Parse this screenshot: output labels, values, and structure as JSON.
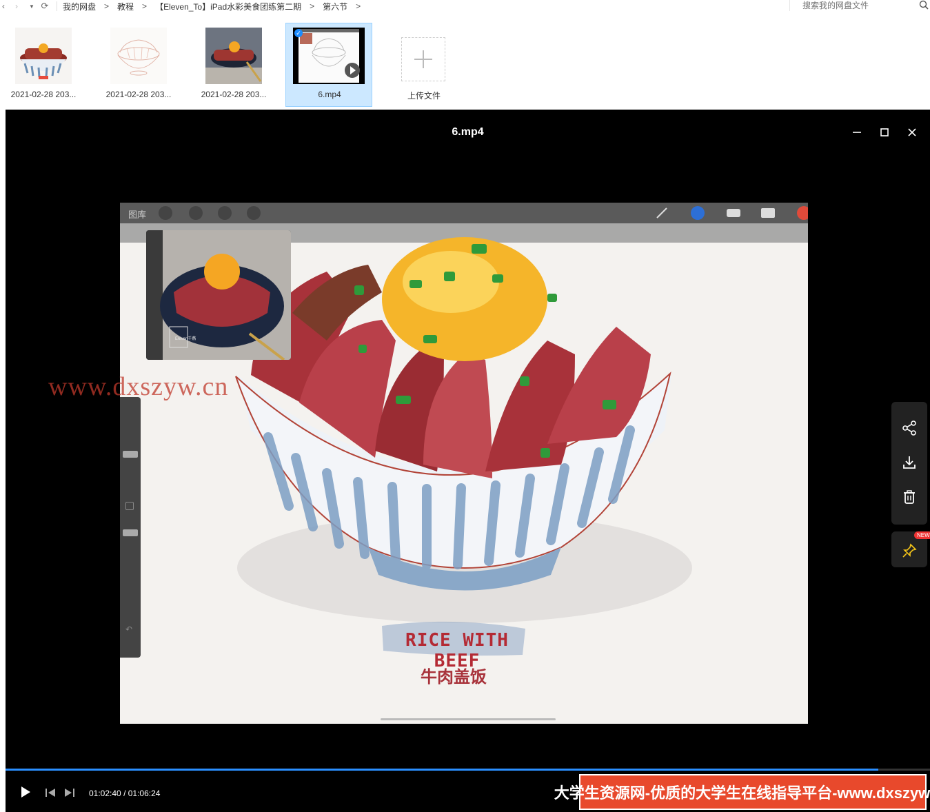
{
  "nav": {
    "crumbs": [
      "我的网盘",
      "教程",
      "【Eleven_To】iPad水彩美食团练第二期",
      "第六节"
    ],
    "separator": ">",
    "search_placeholder": "搜索我的网盘文件"
  },
  "files": [
    {
      "name": "2021-02-28 203..."
    },
    {
      "name": "2021-02-28 203..."
    },
    {
      "name": "2021-02-28 203..."
    },
    {
      "name": "6.mp4",
      "selected": true
    },
    {
      "name": "上传文件"
    }
  ],
  "player": {
    "title": "6.mp4",
    "time_current": "01:02:40",
    "time_total": "01:06:24",
    "time_separator": "/",
    "progress_fraction": 0.944,
    "new_badge": "NEW"
  },
  "video_frame": {
    "app_gallery": "图库",
    "watermark": "www.dxszyw.cn",
    "ref_label": "Eleven千燕",
    "art_title": "RICE WITH BEEF",
    "art_subtitle": "牛肉盖饭"
  },
  "banner": {
    "text": "大学生资源网-优质的大学生在线指导平台-www.dxszyw.cn"
  },
  "colors": {
    "accent": "#2b8fff",
    "selected_bg": "#cce8ff",
    "banner_bg": "#e8492c",
    "watermark": "#c0392b"
  }
}
